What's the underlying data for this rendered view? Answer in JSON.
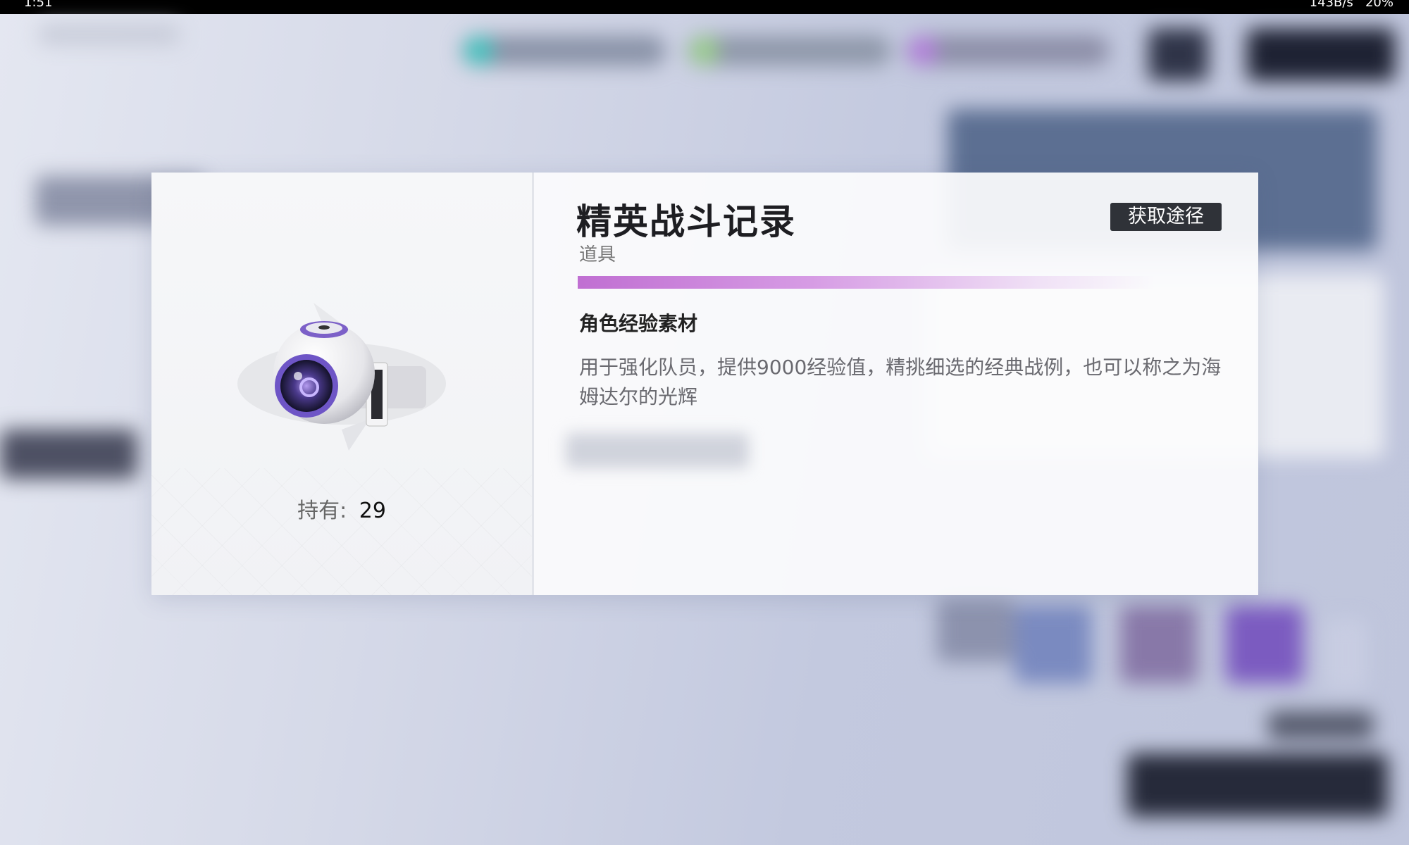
{
  "status_bar": {
    "time": "1:51",
    "net_speed": "143B/s",
    "battery": "20%"
  },
  "item": {
    "name": "精英战斗记录",
    "type": "道具",
    "source_button": "获取途径",
    "category": "角色经验素材",
    "description": "用于强化队员，提供9000经验值，精挑细选的经典战例，也可以称之为海姆达尔的光辉",
    "owned_label": "持有:",
    "owned_count": "29",
    "rarity_color": "#c06fd2"
  }
}
